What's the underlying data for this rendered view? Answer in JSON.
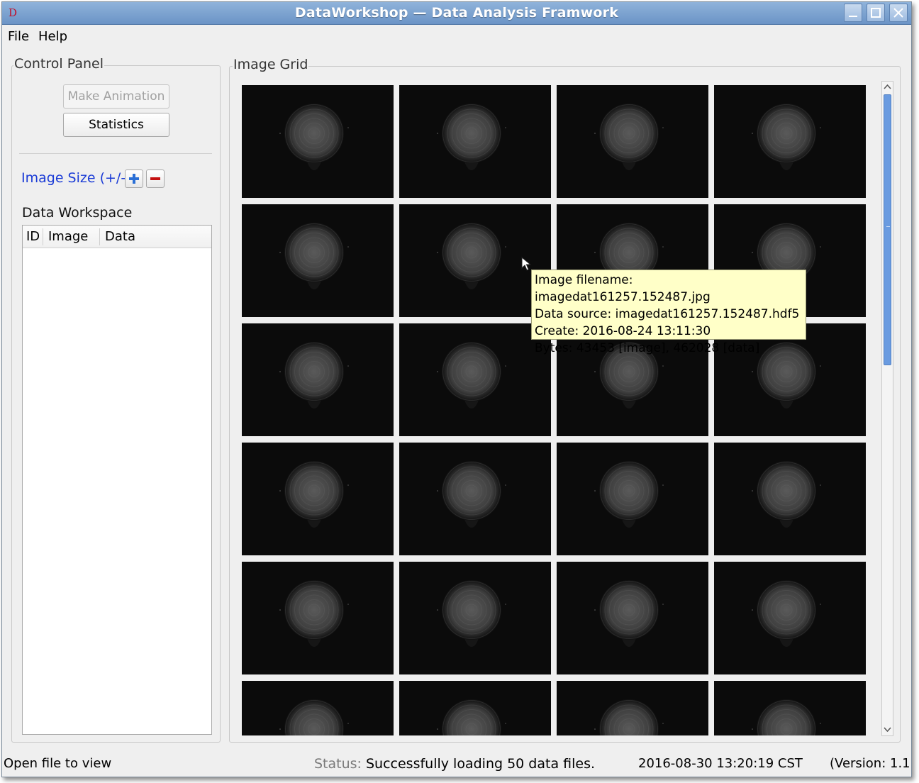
{
  "window": {
    "title": "DataWorkshop — Data Analysis Framwork",
    "app_icon_letter": "D"
  },
  "menu": {
    "items": [
      "File",
      "Help"
    ]
  },
  "control_panel": {
    "title": "Control Panel",
    "make_animation_label": "Make Animation",
    "statistics_label": "Statistics",
    "image_size_label": "Image Size (+/-)",
    "image_size_label_color": "#1a3bd6",
    "data_workspace_label": "Data Workspace",
    "table_columns": [
      "ID",
      "Image",
      "Data"
    ]
  },
  "image_grid": {
    "title": "Image Grid",
    "columns": 4,
    "visible_rows": 6,
    "tooltip": {
      "line1": "Image filename: imagedat161257.152487.jpg",
      "line2": "Data source: imagedat161257.152487.hdf5",
      "line3": "Create: 2016-08-24 13:11:30",
      "line4": "Bytes: 43453 [image], 462028 [data]"
    }
  },
  "statusbar": {
    "message": "Open file to view",
    "status_label": "Status:",
    "status_text": "Successfully loading 50 data files.",
    "timestamp": "2016-08-30 13:20:19 CST",
    "version": "(Version: 1.1)"
  },
  "colors": {
    "titlebar": "#7ea4d2",
    "scrollbar_thumb": "#6a9be0",
    "tooltip_bg": "#ffffc8",
    "plus_icon": "#2a6fd6",
    "minus_icon": "#c41010"
  }
}
